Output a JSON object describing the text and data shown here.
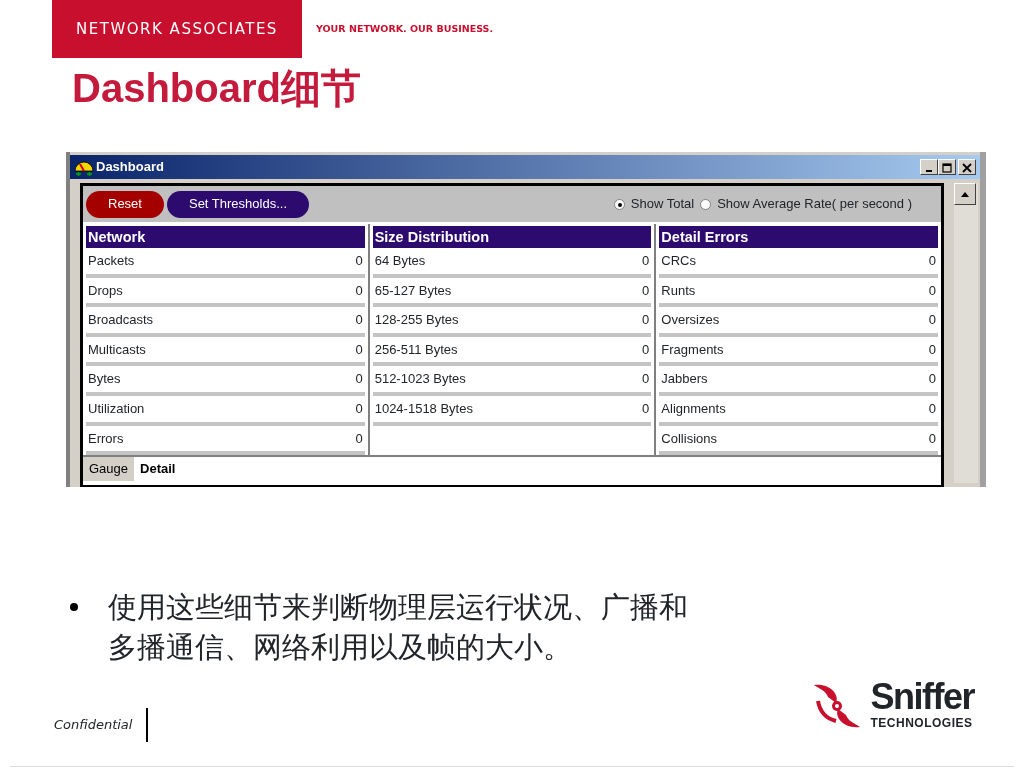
{
  "header": {
    "brand": "NETWORK ASSOCIATES",
    "tagline": "YOUR NETWORK. OUR BUSINESS."
  },
  "title": "Dashboard细节",
  "window": {
    "title": "Dashboard",
    "buttons": [
      {
        "label": "Reset",
        "kind": "danger"
      },
      {
        "label": "Set Thresholds...",
        "kind": "primary"
      }
    ],
    "display_options": [
      {
        "label": "Show Total",
        "selected": true
      },
      {
        "label": "Show Average Rate( per second )",
        "selected": false
      }
    ],
    "panels": [
      {
        "title": "Network",
        "rows": [
          {
            "label": "Packets",
            "value": "0"
          },
          {
            "label": "Drops",
            "value": "0"
          },
          {
            "label": "Broadcasts",
            "value": "0"
          },
          {
            "label": "Multicasts",
            "value": "0"
          },
          {
            "label": "Bytes",
            "value": "0"
          },
          {
            "label": "Utilization",
            "value": "0"
          },
          {
            "label": "Errors",
            "value": "0"
          }
        ]
      },
      {
        "title": "Size Distribution",
        "rows": [
          {
            "label": "64 Bytes",
            "value": "0"
          },
          {
            "label": "65-127 Bytes",
            "value": "0"
          },
          {
            "label": "128-255 Bytes",
            "value": "0"
          },
          {
            "label": "256-511 Bytes",
            "value": "0"
          },
          {
            "label": "512-1023 Bytes",
            "value": "0"
          },
          {
            "label": "1024-1518 Bytes",
            "value": "0"
          }
        ]
      },
      {
        "title": "Detail Errors",
        "rows": [
          {
            "label": "CRCs",
            "value": "0"
          },
          {
            "label": "Runts",
            "value": "0"
          },
          {
            "label": "Oversizes",
            "value": "0"
          },
          {
            "label": "Fragments",
            "value": "0"
          },
          {
            "label": "Jabbers",
            "value": "0"
          },
          {
            "label": "Alignments",
            "value": "0"
          },
          {
            "label": "Collisions",
            "value": "0"
          }
        ]
      }
    ],
    "tabs": [
      {
        "label": "Gauge",
        "selected": false
      },
      {
        "label": "Detail",
        "selected": true
      }
    ]
  },
  "bullets": [
    "使用这些细节来判断物理层运行状况、广播和多播通信、网络利用以及帧的大小。"
  ],
  "footer": {
    "confidential": "Confidential",
    "logo_name": "Sniffer",
    "logo_sub": "TECHNOLOGIES"
  }
}
